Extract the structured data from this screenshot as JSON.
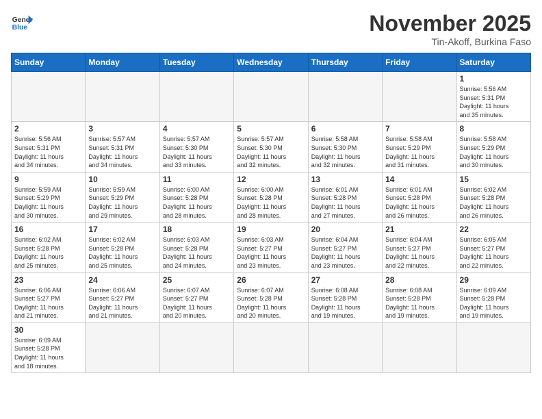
{
  "header": {
    "logo_general": "General",
    "logo_blue": "Blue",
    "month_title": "November 2025",
    "location": "Tin-Akoff, Burkina Faso"
  },
  "days_of_week": [
    "Sunday",
    "Monday",
    "Tuesday",
    "Wednesday",
    "Thursday",
    "Friday",
    "Saturday"
  ],
  "weeks": [
    [
      {
        "day": "",
        "info": ""
      },
      {
        "day": "",
        "info": ""
      },
      {
        "day": "",
        "info": ""
      },
      {
        "day": "",
        "info": ""
      },
      {
        "day": "",
        "info": ""
      },
      {
        "day": "",
        "info": ""
      },
      {
        "day": "1",
        "info": "Sunrise: 5:56 AM\nSunset: 5:31 PM\nDaylight: 11 hours\nand 35 minutes."
      }
    ],
    [
      {
        "day": "2",
        "info": "Sunrise: 5:56 AM\nSunset: 5:31 PM\nDaylight: 11 hours\nand 34 minutes."
      },
      {
        "day": "3",
        "info": "Sunrise: 5:57 AM\nSunset: 5:31 PM\nDaylight: 11 hours\nand 34 minutes."
      },
      {
        "day": "4",
        "info": "Sunrise: 5:57 AM\nSunset: 5:30 PM\nDaylight: 11 hours\nand 33 minutes."
      },
      {
        "day": "5",
        "info": "Sunrise: 5:57 AM\nSunset: 5:30 PM\nDaylight: 11 hours\nand 32 minutes."
      },
      {
        "day": "6",
        "info": "Sunrise: 5:58 AM\nSunset: 5:30 PM\nDaylight: 11 hours\nand 32 minutes."
      },
      {
        "day": "7",
        "info": "Sunrise: 5:58 AM\nSunset: 5:29 PM\nDaylight: 11 hours\nand 31 minutes."
      },
      {
        "day": "8",
        "info": "Sunrise: 5:58 AM\nSunset: 5:29 PM\nDaylight: 11 hours\nand 30 minutes."
      }
    ],
    [
      {
        "day": "9",
        "info": "Sunrise: 5:59 AM\nSunset: 5:29 PM\nDaylight: 11 hours\nand 30 minutes."
      },
      {
        "day": "10",
        "info": "Sunrise: 5:59 AM\nSunset: 5:29 PM\nDaylight: 11 hours\nand 29 minutes."
      },
      {
        "day": "11",
        "info": "Sunrise: 6:00 AM\nSunset: 5:28 PM\nDaylight: 11 hours\nand 28 minutes."
      },
      {
        "day": "12",
        "info": "Sunrise: 6:00 AM\nSunset: 5:28 PM\nDaylight: 11 hours\nand 28 minutes."
      },
      {
        "day": "13",
        "info": "Sunrise: 6:01 AM\nSunset: 5:28 PM\nDaylight: 11 hours\nand 27 minutes."
      },
      {
        "day": "14",
        "info": "Sunrise: 6:01 AM\nSunset: 5:28 PM\nDaylight: 11 hours\nand 26 minutes."
      },
      {
        "day": "15",
        "info": "Sunrise: 6:02 AM\nSunset: 5:28 PM\nDaylight: 11 hours\nand 26 minutes."
      }
    ],
    [
      {
        "day": "16",
        "info": "Sunrise: 6:02 AM\nSunset: 5:28 PM\nDaylight: 11 hours\nand 25 minutes."
      },
      {
        "day": "17",
        "info": "Sunrise: 6:02 AM\nSunset: 5:28 PM\nDaylight: 11 hours\nand 25 minutes."
      },
      {
        "day": "18",
        "info": "Sunrise: 6:03 AM\nSunset: 5:28 PM\nDaylight: 11 hours\nand 24 minutes."
      },
      {
        "day": "19",
        "info": "Sunrise: 6:03 AM\nSunset: 5:27 PM\nDaylight: 11 hours\nand 23 minutes."
      },
      {
        "day": "20",
        "info": "Sunrise: 6:04 AM\nSunset: 5:27 PM\nDaylight: 11 hours\nand 23 minutes."
      },
      {
        "day": "21",
        "info": "Sunrise: 6:04 AM\nSunset: 5:27 PM\nDaylight: 11 hours\nand 22 minutes."
      },
      {
        "day": "22",
        "info": "Sunrise: 6:05 AM\nSunset: 5:27 PM\nDaylight: 11 hours\nand 22 minutes."
      }
    ],
    [
      {
        "day": "23",
        "info": "Sunrise: 6:06 AM\nSunset: 5:27 PM\nDaylight: 11 hours\nand 21 minutes."
      },
      {
        "day": "24",
        "info": "Sunrise: 6:06 AM\nSunset: 5:27 PM\nDaylight: 11 hours\nand 21 minutes."
      },
      {
        "day": "25",
        "info": "Sunrise: 6:07 AM\nSunset: 5:27 PM\nDaylight: 11 hours\nand 20 minutes."
      },
      {
        "day": "26",
        "info": "Sunrise: 6:07 AM\nSunset: 5:28 PM\nDaylight: 11 hours\nand 20 minutes."
      },
      {
        "day": "27",
        "info": "Sunrise: 6:08 AM\nSunset: 5:28 PM\nDaylight: 11 hours\nand 19 minutes."
      },
      {
        "day": "28",
        "info": "Sunrise: 6:08 AM\nSunset: 5:28 PM\nDaylight: 11 hours\nand 19 minutes."
      },
      {
        "day": "29",
        "info": "Sunrise: 6:09 AM\nSunset: 5:28 PM\nDaylight: 11 hours\nand 19 minutes."
      }
    ],
    [
      {
        "day": "30",
        "info": "Sunrise: 6:09 AM\nSunset: 5:28 PM\nDaylight: 11 hours\nand 18 minutes."
      },
      {
        "day": "",
        "info": ""
      },
      {
        "day": "",
        "info": ""
      },
      {
        "day": "",
        "info": ""
      },
      {
        "day": "",
        "info": ""
      },
      {
        "day": "",
        "info": ""
      },
      {
        "day": "",
        "info": ""
      }
    ]
  ]
}
